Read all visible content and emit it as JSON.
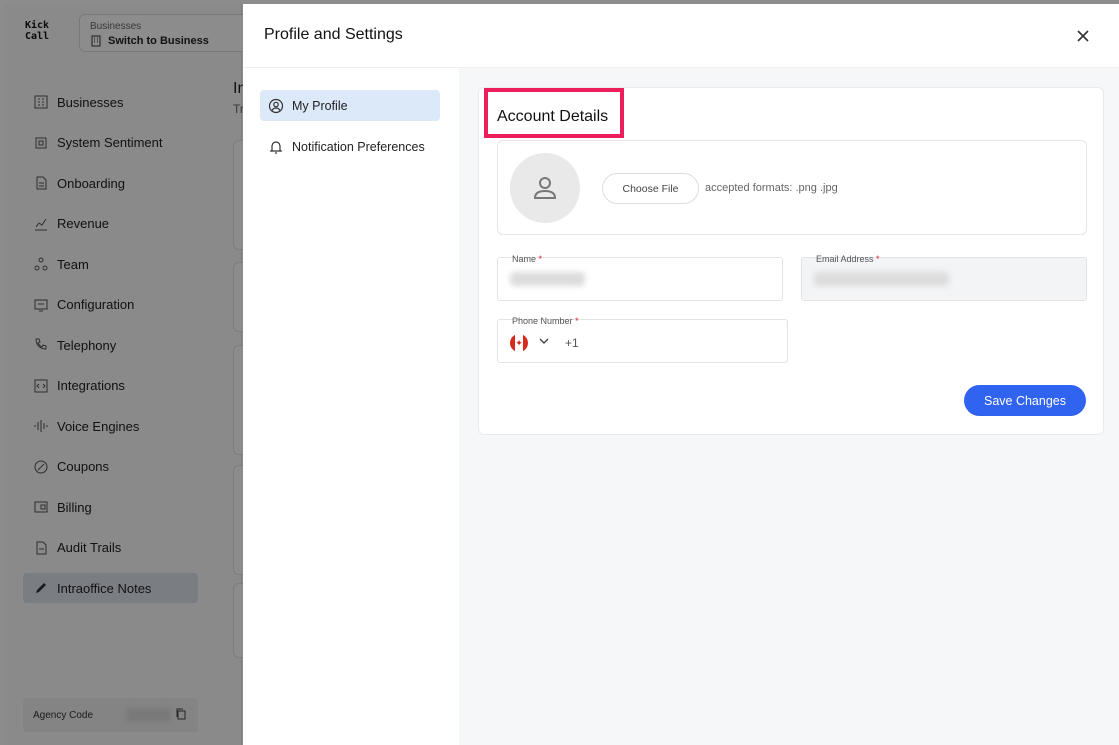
{
  "app": {
    "logo": "Kick\nCall",
    "business_switch": {
      "caption": "Businesses",
      "value": "Switch to Business"
    },
    "nav": [
      {
        "label": "Businesses",
        "icon": "building-icon"
      },
      {
        "label": "System Sentiment",
        "icon": "sentiment-icon"
      },
      {
        "label": "Onboarding",
        "icon": "document-icon"
      },
      {
        "label": "Revenue",
        "icon": "revenue-icon"
      },
      {
        "label": "Team",
        "icon": "team-icon"
      },
      {
        "label": "Configuration",
        "icon": "configuration-icon"
      },
      {
        "label": "Telephony",
        "icon": "phone-icon"
      },
      {
        "label": "Integrations",
        "icon": "integrations-icon"
      },
      {
        "label": "Voice Engines",
        "icon": "waveform-icon"
      },
      {
        "label": "Coupons",
        "icon": "coupon-icon"
      },
      {
        "label": "Billing",
        "icon": "wallet-icon"
      },
      {
        "label": "Audit Trails",
        "icon": "audit-icon"
      },
      {
        "label": "Intraoffice Notes",
        "icon": "pencil-icon",
        "active": true
      }
    ],
    "agency_label": "Agency Code",
    "main_title": "In",
    "main_sub": "Tr"
  },
  "modal": {
    "title": "Profile and Settings",
    "nav": [
      {
        "label": "My Profile",
        "icon": "user-circle-icon",
        "active": true
      },
      {
        "label": "Notification Preferences",
        "icon": "bell-icon"
      }
    ],
    "section_title": "Account Details",
    "choose_file": "Choose File",
    "formats": "accepted formats: .png .jpg",
    "name_label": "Name",
    "email_label": "Email Address",
    "phone_label": "Phone Number",
    "required_mark": "*",
    "phone_code": "+1",
    "country_flag": "canada-flag",
    "save_label": "Save Changes"
  },
  "colors": {
    "accent": "#2f63f0",
    "highlight": "#ec1f5c",
    "active_nav": "#dbe9f8",
    "required": "#d61f3a"
  }
}
